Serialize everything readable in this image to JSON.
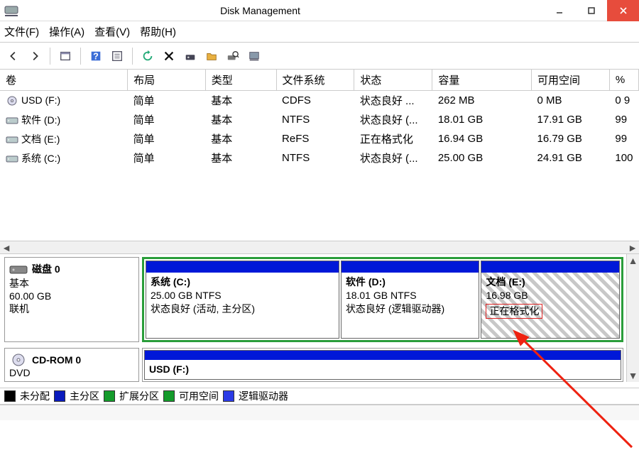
{
  "window": {
    "title": "Disk Management"
  },
  "menu": {
    "file": "文件(F)",
    "action": "操作(A)",
    "view": "查看(V)",
    "help": "帮助(H)"
  },
  "columns": {
    "volume": "卷",
    "layout": "布局",
    "type": "类型",
    "fs": "文件系统",
    "status": "状态",
    "capacity": "容量",
    "free": "可用空间",
    "pct": "%"
  },
  "volumes": [
    {
      "icon": "disc",
      "name": "USD (F:)",
      "layout": "简单",
      "type": "基本",
      "fs": "CDFS",
      "status": "状态良好 ...",
      "capacity": "262 MB",
      "free": "0 MB",
      "pct": "0 9"
    },
    {
      "icon": "drive",
      "name": "软件 (D:)",
      "layout": "简单",
      "type": "基本",
      "fs": "NTFS",
      "status": "状态良好 (...",
      "capacity": "18.01 GB",
      "free": "17.91 GB",
      "pct": "99"
    },
    {
      "icon": "drive",
      "name": "文档 (E:)",
      "layout": "简单",
      "type": "基本",
      "fs": "ReFS",
      "status": "正在格式化",
      "capacity": "16.94 GB",
      "free": "16.79 GB",
      "pct": "99"
    },
    {
      "icon": "drive",
      "name": "系统 (C:)",
      "layout": "简单",
      "type": "基本",
      "fs": "NTFS",
      "status": "状态良好 (...",
      "capacity": "25.00 GB",
      "free": "24.91 GB",
      "pct": "100"
    }
  ],
  "disk0": {
    "label": "磁盘 0",
    "type": "基本",
    "size": "60.00 GB",
    "state": "联机",
    "parts": [
      {
        "title": "系统  (C:)",
        "line2": "25.00 GB NTFS",
        "line3": "状态良好 (活动, 主分区)"
      },
      {
        "title": "软件  (D:)",
        "line2": "18.01 GB NTFS",
        "line3": "状态良好 (逻辑驱动器)"
      },
      {
        "title": "文档  (E:)",
        "line2": "16.98 GB",
        "line3": "正在格式化"
      }
    ]
  },
  "cdrom": {
    "label": "CD-ROM 0",
    "type": "DVD",
    "part_title": "USD  (F:)"
  },
  "legend": {
    "unalloc": "未分配",
    "primary": "主分区",
    "extended": "扩展分区",
    "freespace": "可用空间",
    "logical": "逻辑驱动器"
  },
  "colors": {
    "unalloc": "#000000",
    "primary": "#0a1bbd",
    "extended": "#149b2b",
    "freespace": "#149b2b",
    "logical": "#2b3be6"
  }
}
